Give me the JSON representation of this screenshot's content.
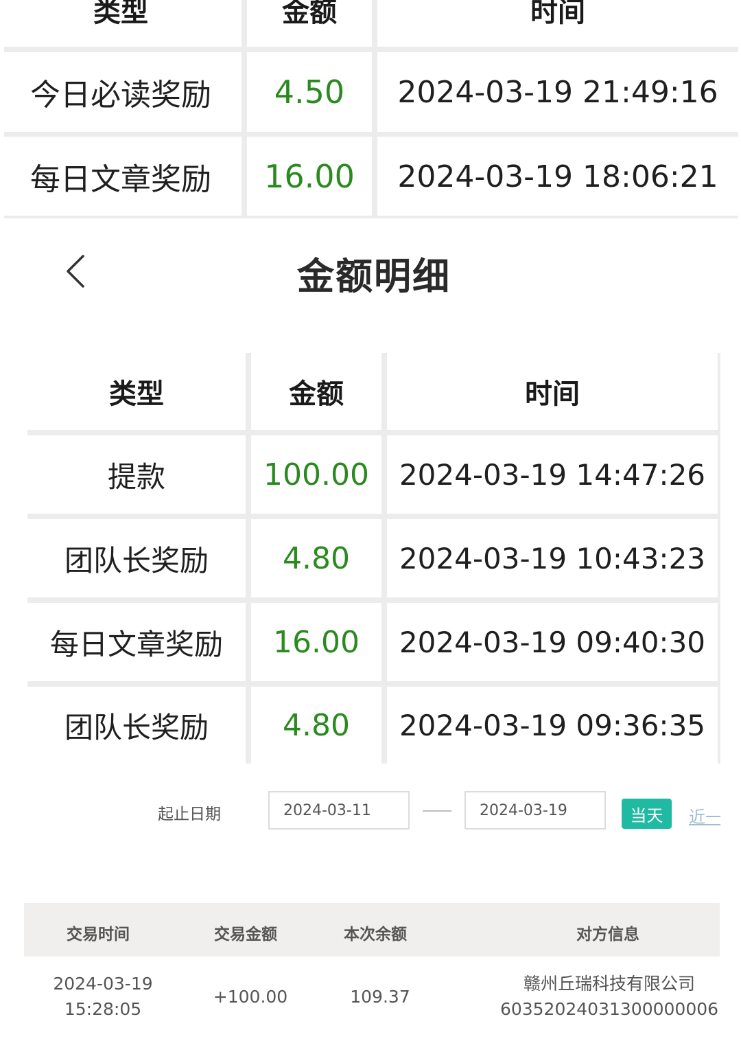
{
  "top_table": {
    "headers": [
      "类型",
      "金额",
      "时间"
    ],
    "rows": [
      {
        "type": "今日必读奖励",
        "amount": "4.50",
        "time": "2024-03-19 21:49:16"
      },
      {
        "type": "每日文章奖励",
        "amount": "16.00",
        "time": "2024-03-19 18:06:21"
      }
    ]
  },
  "header": {
    "title": "金额明细"
  },
  "detail_table": {
    "headers": [
      "类型",
      "金额",
      "时间"
    ],
    "rows": [
      {
        "type": "提款",
        "amount": "100.00",
        "time": "2024-03-19 14:47:26"
      },
      {
        "type": "团队长奖励",
        "amount": "4.80",
        "time": "2024-03-19 10:43:23"
      },
      {
        "type": "每日文章奖励",
        "amount": "16.00",
        "time": "2024-03-19 09:40:30"
      },
      {
        "type": "团队长奖励",
        "amount": "4.80",
        "time": "2024-03-19 09:36:35"
      }
    ]
  },
  "filter": {
    "label": "起止日期",
    "start_date": "2024-03-11",
    "end_date": "2024-03-19",
    "today_button": "当天",
    "recent_link": "近一"
  },
  "transactions": {
    "headers": [
      "交易时间",
      "交易金额",
      "本次余额",
      "对方信息"
    ],
    "rows": [
      {
        "date": "2024-03-19",
        "time": "15:28:05",
        "amount": "+100.00",
        "balance": "109.37",
        "counterparty_name": "赣州丘瑞科技有限公司",
        "counterparty_account": "60352024031300000006"
      }
    ]
  },
  "colors": {
    "amount_green": "#2b8a1f",
    "accent_teal": "#20b9a2",
    "grid_line": "#ececec"
  }
}
